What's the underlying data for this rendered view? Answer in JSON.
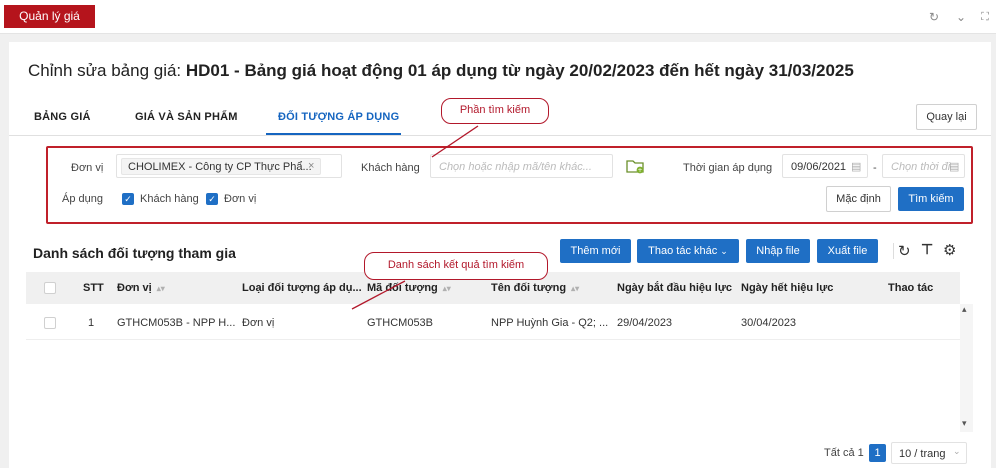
{
  "app": {
    "title": "Quản lý giá",
    "top_icons": [
      "refresh-icon",
      "chevron-down-icon",
      "fullscreen-icon"
    ]
  },
  "page": {
    "title_prefix": "Chỉnh sửa bảng giá: ",
    "title_main": "HD01 - Bảng giá hoạt động 01 áp dụng từ ngày 20/02/2023 đến hết ngày 31/03/2025"
  },
  "tabs": [
    {
      "label": "BẢNG GIÁ",
      "active": false
    },
    {
      "label": "GIÁ VÀ SẢN PHẨM",
      "active": false
    },
    {
      "label": "ĐỐI TƯỢNG ÁP DỤNG",
      "active": true
    }
  ],
  "back_button": "Quay lại",
  "search": {
    "don_vi_label": "Đơn vị",
    "don_vi_tag": "CHOLIMEX - Công ty CP Thực Phẩ...",
    "khach_hang_label": "Khách hàng",
    "khach_hang_placeholder": "Chọn hoặc nhập mã/tên khác...",
    "thoi_gian_label": "Thời gian áp dụng",
    "date_from": "09/06/2021",
    "date_separator": "-",
    "date_to_placeholder": "Chọn thời điểm",
    "ap_dung_label": "Áp dụng",
    "checkbox_khach_hang": "Khách hàng",
    "checkbox_don_vi": "Đơn vị",
    "default_button": "Mặc định",
    "search_button": "Tìm kiếm"
  },
  "annotations": {
    "search_callout": "Phần tìm kiếm",
    "results_callout": "Danh sách kết quả tìm kiếm"
  },
  "list": {
    "title": "Danh sách đối tượng tham gia",
    "buttons": {
      "add": "Thêm mới",
      "other": "Thao tác khác",
      "import": "Nhập file",
      "export": "Xuất file"
    },
    "columns": [
      "STT",
      "Đơn vị",
      "Loại đối tượng áp dụ...",
      "Mã đối tượng",
      "Tên đối tượng",
      "Ngày bắt đầu hiệu lực",
      "Ngày hết hiệu lực",
      "Thao tác"
    ],
    "rows": [
      {
        "stt": "1",
        "don_vi": "GTHCM053B - NPP H...",
        "loai": "Đơn vị",
        "ma": "GTHCM053B",
        "ten": "NPP Huỳnh Gia - Q2; ...",
        "bat_dau": "29/04/2023",
        "het": "30/04/2023"
      }
    ]
  },
  "pagination": {
    "total": "Tất cả 1",
    "page": "1",
    "page_size": "10 / trang"
  },
  "colors": {
    "brand": "#b5141c",
    "primary": "#1f6fc5",
    "callout": "#b2182b"
  }
}
